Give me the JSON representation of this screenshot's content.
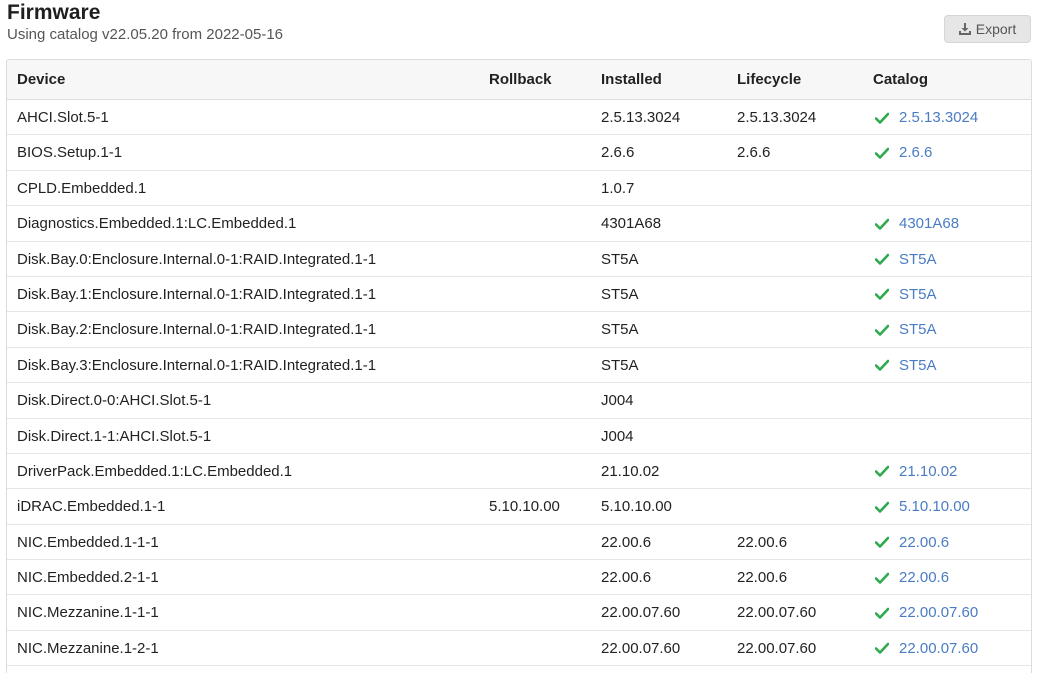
{
  "header": {
    "title": "Firmware",
    "subtitle": "Using catalog v22.05.20 from 2022-05-16",
    "export_label": "Export"
  },
  "table": {
    "columns": [
      "Device",
      "Rollback",
      "Installed",
      "Lifecycle",
      "Catalog"
    ],
    "rows": [
      {
        "device": "AHCI.Slot.5-1",
        "rollback": "",
        "installed": "2.5.13.3024",
        "lifecycle": "2.5.13.3024",
        "catalog": "2.5.13.3024"
      },
      {
        "device": "BIOS.Setup.1-1",
        "rollback": "",
        "installed": "2.6.6",
        "lifecycle": "2.6.6",
        "catalog": "2.6.6"
      },
      {
        "device": "CPLD.Embedded.1",
        "rollback": "",
        "installed": "1.0.7",
        "lifecycle": "",
        "catalog": ""
      },
      {
        "device": "Diagnostics.Embedded.1:LC.Embedded.1",
        "rollback": "",
        "installed": "4301A68",
        "lifecycle": "",
        "catalog": "4301A68"
      },
      {
        "device": "Disk.Bay.0:Enclosure.Internal.0-1:RAID.Integrated.1-1",
        "rollback": "",
        "installed": "ST5A",
        "lifecycle": "",
        "catalog": "ST5A"
      },
      {
        "device": "Disk.Bay.1:Enclosure.Internal.0-1:RAID.Integrated.1-1",
        "rollback": "",
        "installed": "ST5A",
        "lifecycle": "",
        "catalog": "ST5A"
      },
      {
        "device": "Disk.Bay.2:Enclosure.Internal.0-1:RAID.Integrated.1-1",
        "rollback": "",
        "installed": "ST5A",
        "lifecycle": "",
        "catalog": "ST5A"
      },
      {
        "device": "Disk.Bay.3:Enclosure.Internal.0-1:RAID.Integrated.1-1",
        "rollback": "",
        "installed": "ST5A",
        "lifecycle": "",
        "catalog": "ST5A"
      },
      {
        "device": "Disk.Direct.0-0:AHCI.Slot.5-1",
        "rollback": "",
        "installed": "J004",
        "lifecycle": "",
        "catalog": ""
      },
      {
        "device": "Disk.Direct.1-1:AHCI.Slot.5-1",
        "rollback": "",
        "installed": "J004",
        "lifecycle": "",
        "catalog": ""
      },
      {
        "device": "DriverPack.Embedded.1:LC.Embedded.1",
        "rollback": "",
        "installed": "21.10.02",
        "lifecycle": "",
        "catalog": "21.10.02"
      },
      {
        "device": "iDRAC.Embedded.1-1",
        "rollback": "5.10.10.00",
        "installed": "5.10.10.00",
        "lifecycle": "",
        "catalog": "5.10.10.00"
      },
      {
        "device": "NIC.Embedded.1-1-1",
        "rollback": "",
        "installed": "22.00.6",
        "lifecycle": "22.00.6",
        "catalog": "22.00.6"
      },
      {
        "device": "NIC.Embedded.2-1-1",
        "rollback": "",
        "installed": "22.00.6",
        "lifecycle": "22.00.6",
        "catalog": "22.00.6"
      },
      {
        "device": "NIC.Mezzanine.1-1-1",
        "rollback": "",
        "installed": "22.00.07.60",
        "lifecycle": "22.00.07.60",
        "catalog": "22.00.07.60"
      },
      {
        "device": "NIC.Mezzanine.1-2-1",
        "rollback": "",
        "installed": "22.00.07.60",
        "lifecycle": "22.00.07.60",
        "catalog": "22.00.07.60"
      }
    ]
  },
  "icons": {
    "export": "download-icon",
    "catalog_status": "check-icon"
  },
  "colors": {
    "check": "#2eaa4f",
    "link": "#4a7cc4",
    "button_bg": "#e6e6e6",
    "header_bg": "#f7f7f7"
  }
}
